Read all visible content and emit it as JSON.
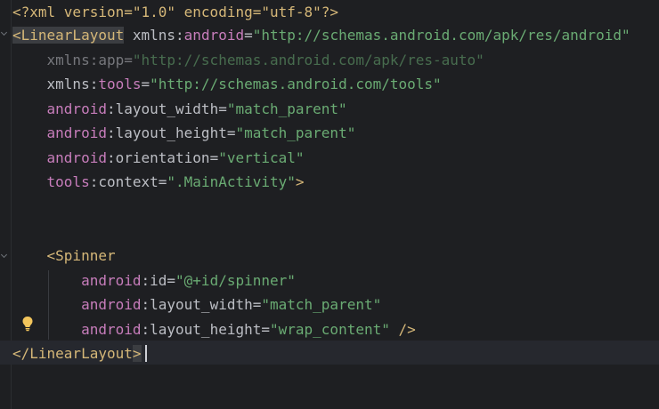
{
  "editor": {
    "lines": [
      {
        "parts": [
          {
            "c": "tag",
            "t": "<?xml version=\"1.0\" encoding=\"utf-8\"?>"
          }
        ]
      },
      {
        "parts": [
          {
            "c": "tag-hl",
            "t": "<LinearLayout"
          },
          {
            "c": "attr",
            "t": " xmlns:"
          },
          {
            "c": "ns",
            "t": "android"
          },
          {
            "c": "attr",
            "t": "="
          },
          {
            "c": "str",
            "t": "\"http://schemas.android.com/apk/res/android\""
          }
        ]
      },
      {
        "parts": [
          {
            "c": "attr dim",
            "t": "    xmlns:app="
          },
          {
            "c": "str dim",
            "t": "\"http://schemas.android.com/apk/res-auto\""
          }
        ]
      },
      {
        "parts": [
          {
            "c": "attr",
            "t": "    xmlns:"
          },
          {
            "c": "ns",
            "t": "tools"
          },
          {
            "c": "attr",
            "t": "="
          },
          {
            "c": "str",
            "t": "\"http://schemas.android.com/tools\""
          }
        ]
      },
      {
        "parts": [
          {
            "c": "ns",
            "t": "    android"
          },
          {
            "c": "attr",
            "t": ":layout_width="
          },
          {
            "c": "str",
            "t": "\"match_parent\""
          }
        ]
      },
      {
        "parts": [
          {
            "c": "ns",
            "t": "    android"
          },
          {
            "c": "attr",
            "t": ":layout_height="
          },
          {
            "c": "str",
            "t": "\"match_parent\""
          }
        ]
      },
      {
        "parts": [
          {
            "c": "ns",
            "t": "    android"
          },
          {
            "c": "attr",
            "t": ":orientation="
          },
          {
            "c": "str",
            "t": "\"vertical\""
          }
        ]
      },
      {
        "parts": [
          {
            "c": "ns",
            "t": "    tools"
          },
          {
            "c": "attr",
            "t": ":context="
          },
          {
            "c": "str",
            "t": "\".MainActivity\""
          },
          {
            "c": "tag",
            "t": ">"
          }
        ]
      },
      {
        "parts": []
      },
      {
        "parts": []
      },
      {
        "parts": [
          {
            "c": "tag",
            "t": "    <Spinner"
          }
        ]
      },
      {
        "parts": [
          {
            "c": "ns",
            "t": "        android"
          },
          {
            "c": "attr",
            "t": ":id="
          },
          {
            "c": "str",
            "t": "\"@+id/spinner\""
          }
        ]
      },
      {
        "parts": [
          {
            "c": "ns",
            "t": "        android"
          },
          {
            "c": "attr",
            "t": ":layout_width="
          },
          {
            "c": "str",
            "t": "\"match_parent\""
          }
        ]
      },
      {
        "parts": [
          {
            "c": "ns",
            "t": "        android"
          },
          {
            "c": "attr",
            "t": ":layout_height="
          },
          {
            "c": "str",
            "t": "\"wrap_content\""
          },
          {
            "c": "tag",
            "t": " />"
          }
        ]
      },
      {
        "parts": [
          {
            "c": "tag",
            "t": "</LinearLayout"
          },
          {
            "c": "tag-hl",
            "t": ">"
          }
        ]
      }
    ]
  },
  "icons": {
    "lightbulb": "lightbulb-icon",
    "fold": "fold-arrow-icon"
  },
  "colors": {
    "background": "#1e1f22",
    "tag": "#d5b778",
    "namespace": "#c77dbb",
    "string": "#6aab73",
    "text": "#bcbec4",
    "lightbulb": "#f2c55c"
  }
}
